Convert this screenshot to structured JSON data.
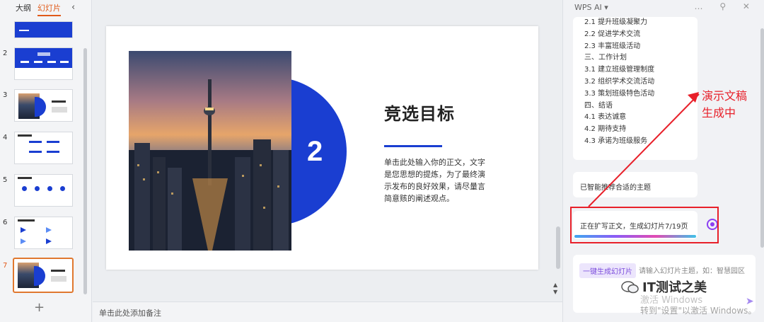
{
  "left_panel": {
    "tab_outline": "大纲",
    "tab_slides": "幻灯片",
    "thumbnails": [
      {
        "num": "2",
        "label": "目录"
      },
      {
        "num": "3",
        "label": "竞选目标"
      },
      {
        "num": "4",
        "label": "学术能力"
      },
      {
        "num": "5",
        "label": "班级组织"
      },
      {
        "num": "6",
        "label": "沟通协调能力"
      },
      {
        "num": "7",
        "label": "竞选目标"
      }
    ],
    "add_label": "+"
  },
  "slide": {
    "number": "2",
    "title": "竞选目标",
    "body": "单击此处输入你的正文，文字是您思想的提炼，为了最终演示发布的良好效果，请尽量言简意赅的阐述观点。",
    "accent_color": "#1a3ed1"
  },
  "notes": {
    "placeholder": "单击此处添加备注"
  },
  "ai_panel": {
    "title": "WPS AI ▾",
    "outline": [
      "2.1 提升班级凝聚力",
      "2.2 促进学术交流",
      "2.3 丰富班级活动",
      "三、工作计划",
      "3.1 建立班级管理制度",
      "3.2 组织学术交流活动",
      "3.3 策划班级特色活动",
      "四、结语",
      "4.1 表达诚意",
      "4.2 期待支持",
      "4.3 承诺为班级服务"
    ],
    "theme_msg": "已智能推荐合适的主题",
    "progress_msg": "正在扩写正文，生成幻灯片7/19页",
    "annotation": [
      "演示文稿",
      "生成中"
    ],
    "input_chip": "一键生成幻灯片",
    "input_placeholder": "请输入幻灯片主题，如：智慧园区",
    "watermark_line1": "激活 Windows",
    "watermark_line2": "转到\"设置\"以激活 Windows。",
    "wechat_text": "IT测试之美"
  }
}
